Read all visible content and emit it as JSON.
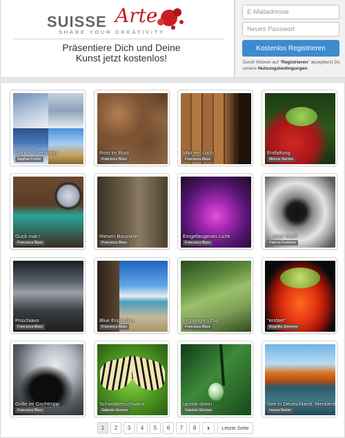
{
  "brand": {
    "word": "SUISSE",
    "script": "Arte",
    "tagline": "SHARE YOUR CREATIVITY"
  },
  "hero": {
    "headline_line1": "Präsentiere Dich und Deine",
    "headline_line2": "Kunst jetzt kostenlos!"
  },
  "signup": {
    "email_placeholder": "E-Mailadresse",
    "email_value": "",
    "password_placeholder": "Neues Passwort",
    "password_value": "",
    "register_label": "Kostenlos Registrieren",
    "terms_prefix": "Durch Klicken auf \"",
    "terms_register": "Registrieren",
    "terms_middle": "\" akzeptierst Du unsere ",
    "terms_link": "Nutzungsbedingungen",
    "terms_suffix": "."
  },
  "gallery": {
    "items": [
      {
        "title": "Light is Everything",
        "author": "Stephan Fuhrer"
      },
      {
        "title": "Rost im Rost",
        "author": "Francesca Blass"
      },
      {
        "title": "Mist ein Loch !",
        "author": "Francesca Blass"
      },
      {
        "title": "Entfaltung",
        "author": "Marcus Sturzbe"
      },
      {
        "title": "Guck mal !",
        "author": "Francesca Blass"
      },
      {
        "title": "Riesen Baustelle",
        "author": "Francesca Blass"
      },
      {
        "title": "Eingefangenes Licht",
        "author": "Francesca Blass"
      },
      {
        "title": "... what else?",
        "author": "Patricia Fischerer"
      },
      {
        "title": "Poschiavo",
        "author": "Francesca Blass"
      },
      {
        "title": "Blue Engiadina",
        "author": "Francesca Blass"
      },
      {
        "title": "Frühling im Zug",
        "author": "Francesca Blass"
      },
      {
        "title": "\"errötet\"",
        "author": "Angelika Jerenova"
      },
      {
        "title": "Grille im Gschtrüpp",
        "author": "Francesca Blass"
      },
      {
        "title": "Schwalbenschwanz",
        "author": "Gabriela Glorioso"
      },
      {
        "title": "upside down",
        "author": "Gabriela Glorioso"
      },
      {
        "title": "See in Deutschland, Mecklenburg",
        "author": "Ioanna Martini"
      }
    ]
  },
  "pagination": {
    "pages": [
      "1",
      "2",
      "3",
      "4",
      "5",
      "6",
      "7",
      "8"
    ],
    "active_page": "1",
    "next_icon": "chevron-right-icon",
    "next_glyph": "›",
    "last_label": "Letzte Seite"
  },
  "colors": {
    "accent": "#3c8bd0",
    "brand_red": "#c91d22",
    "page_bg": "#e6e6e6"
  }
}
